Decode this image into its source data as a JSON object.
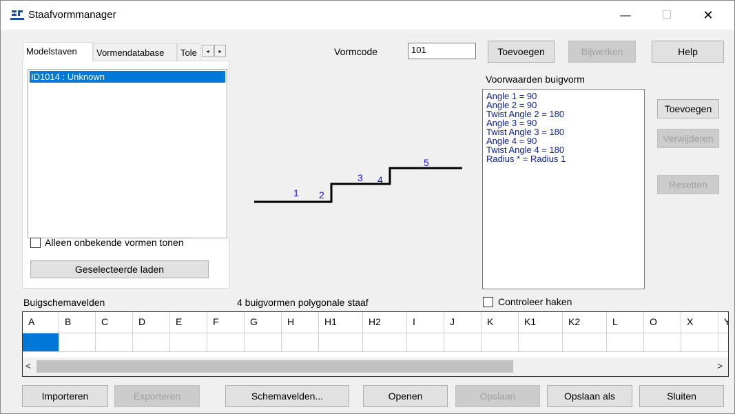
{
  "window": {
    "title": "Staafvormmanager",
    "minimize": "—",
    "maximize": "☐",
    "close": "✕"
  },
  "tabs": [
    {
      "label": "Modelstaven"
    },
    {
      "label": "Vormendatabase"
    },
    {
      "label": "Tole"
    }
  ],
  "tab_scroll": {
    "left": "◂",
    "right": "▸"
  },
  "models_list": {
    "items": [
      "ID1014 : Unknown"
    ]
  },
  "only_unknown_checkbox": {
    "label": "Alleen onbekende vormen tonen",
    "checked": false
  },
  "load_selected_button": "Geselecteerde laden",
  "shape_code": {
    "label": "Vormcode",
    "value": "101"
  },
  "top_buttons": {
    "add": "Toevoegen",
    "update": "Bijwerken",
    "help": "Help"
  },
  "conditions": {
    "label": "Voorwaarden buigvorm",
    "lines": [
      "Angle 1 = 90",
      "Angle 2 = 90",
      "Twist Angle 2 = 180",
      "Angle 3 = 90",
      "Twist Angle 3 = 180",
      "Angle 4 = 90",
      "Twist Angle 4 = 180",
      "Radius * = Radius 1"
    ]
  },
  "condition_buttons": {
    "add": "Toevoegen",
    "remove": "Verwijderen",
    "reset": "Resetten"
  },
  "shape_preview": {
    "segment_labels": [
      "1",
      "2",
      "3",
      "4",
      "5"
    ],
    "line_color": "#000000",
    "label_color": "#1414e6"
  },
  "schema_fields_label": "Buigschemavelden",
  "shape_count_label": "4 buigvormen polygonale staaf",
  "check_hooks_checkbox": {
    "label": "Controleer haken",
    "checked": false
  },
  "grid": {
    "columns": [
      "A",
      "B",
      "C",
      "D",
      "E",
      "F",
      "G",
      "H",
      "H1",
      "H2",
      "I",
      "J",
      "K",
      "K1",
      "K2",
      "L",
      "O",
      "X",
      "Y"
    ],
    "values": [
      "",
      "",
      "",
      "",
      "",
      "",
      "",
      "",
      "",
      "",
      "",
      "",
      "",
      "",
      "",
      "",
      "",
      "",
      ""
    ],
    "scroll_left": "<",
    "scroll_right": ">"
  },
  "bottom_buttons": {
    "import": "Importeren",
    "export": "Exporteren",
    "schema_fields": "Schemavelden...",
    "open": "Openen",
    "save": "Opslaan",
    "save_as": "Opslaan als",
    "close": "Sluiten"
  },
  "colors": {
    "selection": "#0078d7",
    "shape_label": "#1414e6",
    "condition_text": "#0b1f8a"
  }
}
